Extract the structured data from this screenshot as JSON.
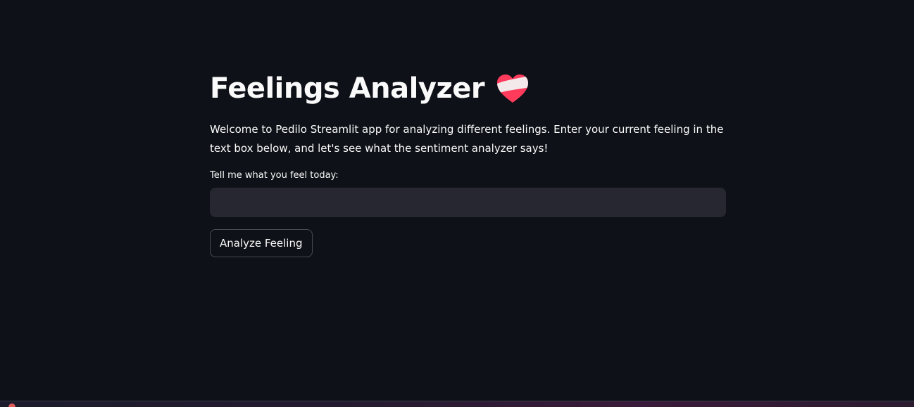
{
  "page": {
    "title": "Feelings Analyzer",
    "title_icon": "heart-emoji-icon",
    "intro": "Welcome to Pedilo Streamlit app for analyzing different feelings. Enter your current feeling in the text box below, and let's see what the sentiment analyzer says!"
  },
  "form": {
    "input_label": "Tell me what you feel today:",
    "input_value": "",
    "input_placeholder": "",
    "button_label": "Analyze Feeling"
  },
  "colors": {
    "background": "#0e1117",
    "input_background": "#262730",
    "text": "#fafafa",
    "heart_red": "#ff3b5c"
  }
}
